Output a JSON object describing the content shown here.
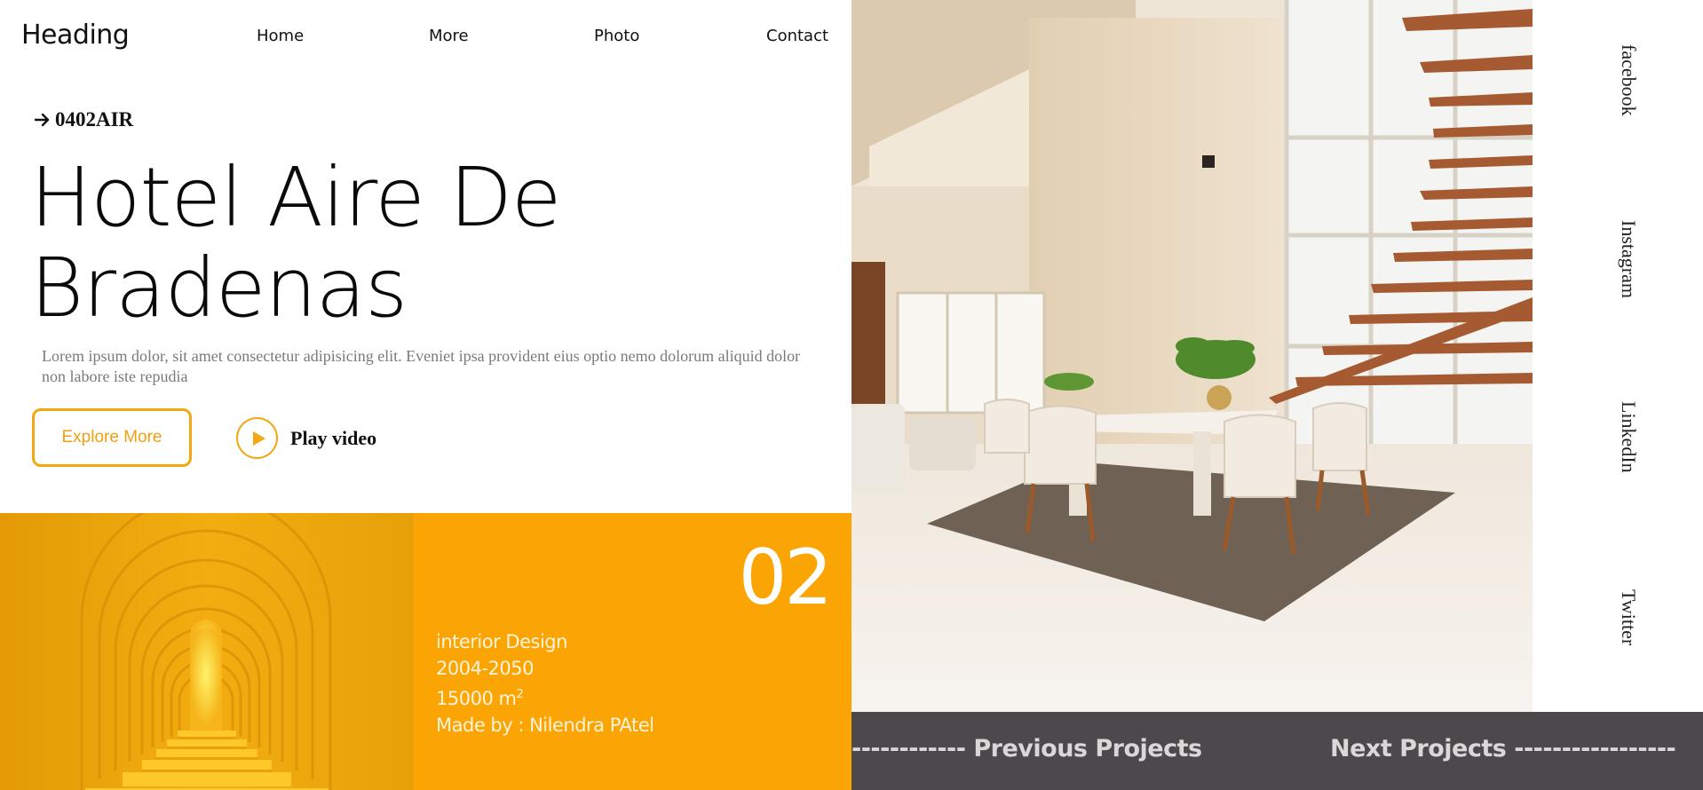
{
  "header": {
    "logo": "Heading",
    "nav": [
      "Home",
      "More",
      "Photo",
      "Contact"
    ]
  },
  "hero": {
    "code": "0402AIR",
    "title_line1": "Hotel Aire De",
    "title_line2": "Bradenas",
    "description": "Lorem ipsum dolor, sit amet consectetur adipisicing elit. Eveniet ipsa provident eius optio nemo dolorum aliquid dolor non labore iste repudia",
    "explore_label": "Explore More",
    "play_label": "Play video"
  },
  "project": {
    "number": "02",
    "category": "interior Design",
    "years": "2004-2050",
    "area_value": "15000 m",
    "area_unit_sup": "2",
    "author": "Made by : Nilendra PAtel"
  },
  "social": [
    "facebook",
    "Instagram",
    "LinkedIn",
    "Twitter"
  ],
  "projects_nav": {
    "previous": "------------ Previous Projects",
    "next": "Next Projects -----------------"
  },
  "colors": {
    "accent": "#fba504",
    "button_border": "#f3a712",
    "bar_bg": "#4b494b"
  }
}
